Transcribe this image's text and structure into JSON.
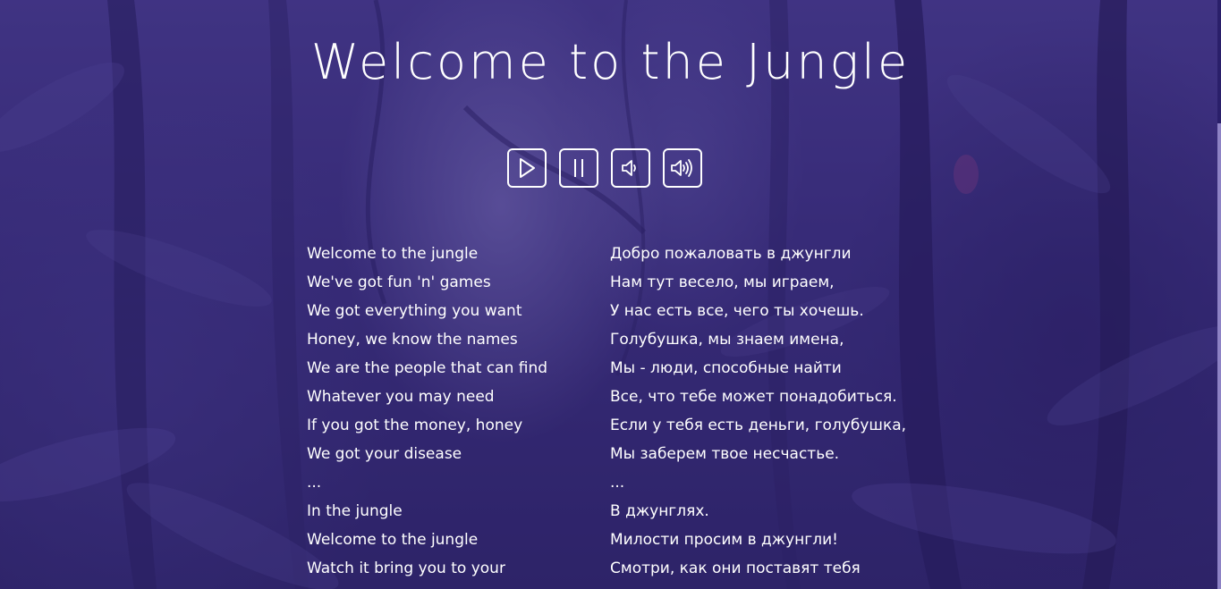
{
  "page": {
    "title": "Welcome to the Jungle"
  },
  "controls": [
    {
      "name": "play-button",
      "icon": "play-icon"
    },
    {
      "name": "pause-button",
      "icon": "pause-icon"
    },
    {
      "name": "volume-down-button",
      "icon": "volume-low-icon"
    },
    {
      "name": "volume-up-button",
      "icon": "volume-high-icon"
    }
  ],
  "lyrics": {
    "original": [
      "Welcome to the jungle",
      "We've got fun 'n' games",
      "We got everything you want",
      "Honey, we know the names",
      "We are the people that can find",
      "Whatever you may need",
      "If you got the money, honey",
      "We got your disease",
      "...",
      "In the jungle",
      "Welcome to the jungle",
      "Watch it bring you to your"
    ],
    "translation": [
      "Добро пожаловать в джунгли",
      "Нам тут весело, мы играем,",
      "У нас есть все, чего ты хочешь.",
      "Голубушка, мы знаем имена,",
      "Мы - люди, способные найти",
      "Все, что тебе может понадобиться.",
      "Если у тебя есть деньги, голубушка,",
      "Мы заберем твое несчастье.",
      "...",
      "В джунглях.",
      "Милости просим в джунгли!",
      "Смотри, как они поставят тебя"
    ]
  },
  "colors": {
    "text": "#ffffff",
    "tint": "#3c2f7a",
    "scrollbar_thumb": "#8d82c4"
  }
}
